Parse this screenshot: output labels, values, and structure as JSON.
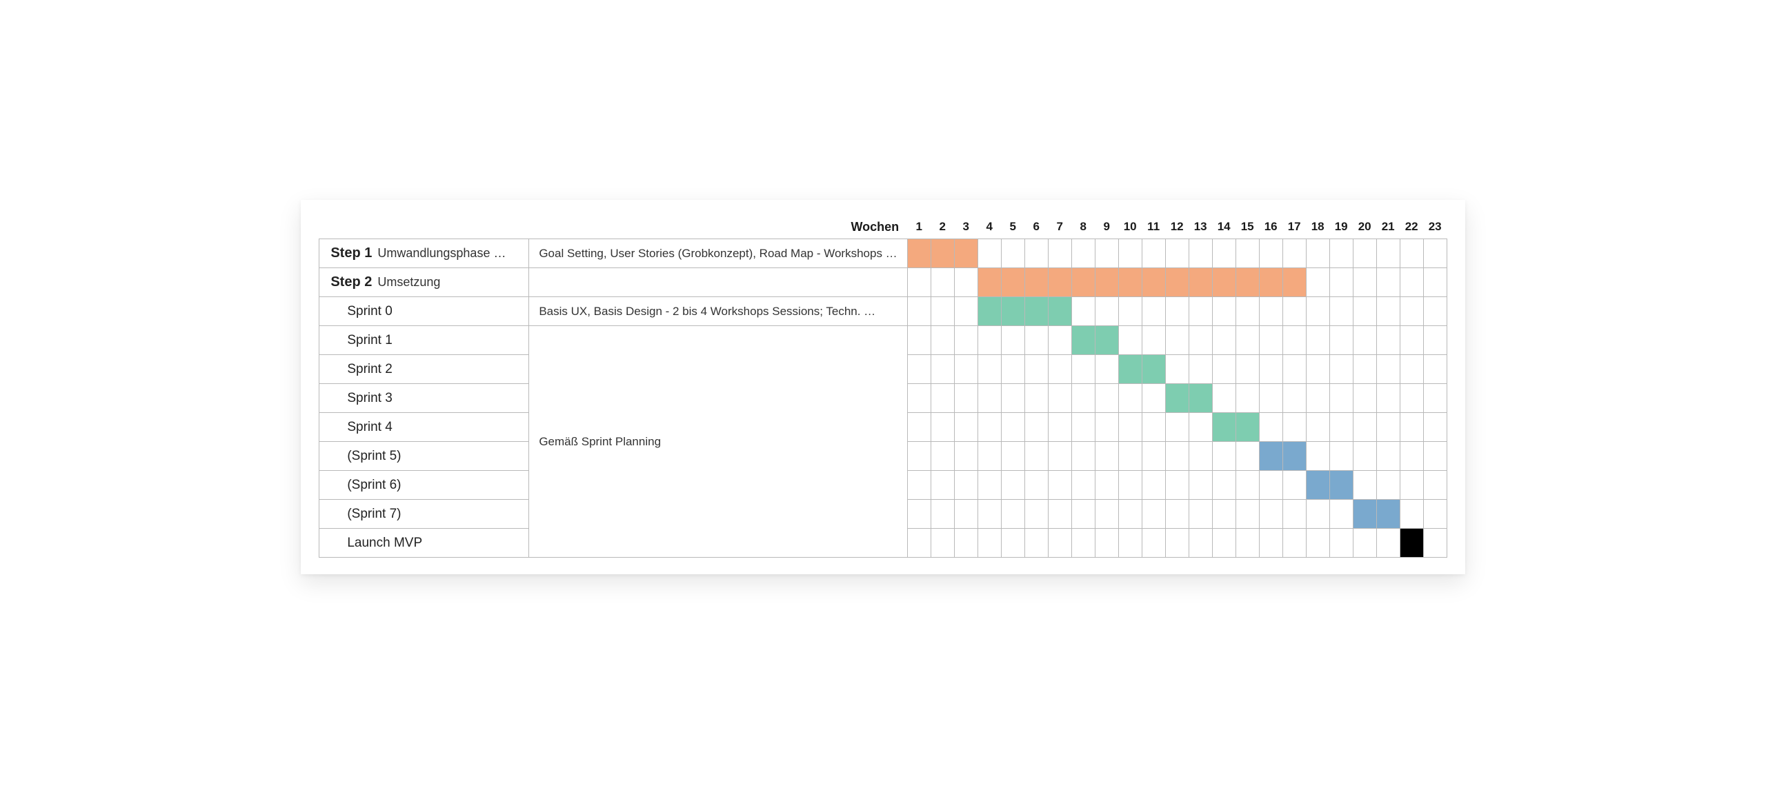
{
  "chart_data": {
    "type": "gantt",
    "title": "",
    "xlabel": "Wochen",
    "categories": [
      1,
      2,
      3,
      4,
      5,
      6,
      7,
      8,
      9,
      10,
      11,
      12,
      13,
      14,
      15,
      16,
      17,
      18,
      19,
      20,
      21,
      22,
      23
    ],
    "colors": {
      "orange": "#f4a97e",
      "green": "#7ecdb0",
      "blue": "#7aa9ce",
      "black": "#000000"
    },
    "rows": [
      {
        "step": "Step 1",
        "sub": "Umwandlungsphase …",
        "indent": false,
        "desc": "Goal Setting, User Stories (Grobkonzept), Road Map - Workshops …",
        "bars": [
          {
            "start": 1,
            "end": 3,
            "color": "orange"
          }
        ]
      },
      {
        "step": "Step 2",
        "sub": "Umsetzung",
        "indent": false,
        "desc": "",
        "bars": [
          {
            "start": 4,
            "end": 17,
            "color": "orange"
          }
        ]
      },
      {
        "name": "Sprint 0",
        "indent": true,
        "desc": "Basis UX, Basis Design - 2 bis 4 Workshops Sessions; Techn.  …",
        "bars": [
          {
            "start": 4,
            "end": 7,
            "color": "green"
          }
        ]
      },
      {
        "name": "Sprint 1",
        "indent": true,
        "desc_group": "Gemäß Sprint Planning",
        "bars": [
          {
            "start": 8,
            "end": 9,
            "color": "green"
          }
        ]
      },
      {
        "name": "Sprint 2",
        "indent": true,
        "bars": [
          {
            "start": 10,
            "end": 11,
            "color": "green"
          }
        ]
      },
      {
        "name": "Sprint 3",
        "indent": true,
        "bars": [
          {
            "start": 12,
            "end": 13,
            "color": "green"
          }
        ]
      },
      {
        "name": "Sprint 4",
        "indent": true,
        "bars": [
          {
            "start": 14,
            "end": 15,
            "color": "green"
          }
        ]
      },
      {
        "name": "(Sprint 5)",
        "indent": true,
        "bars": [
          {
            "start": 16,
            "end": 17,
            "color": "blue"
          }
        ]
      },
      {
        "name": "(Sprint 6)",
        "indent": true,
        "bars": [
          {
            "start": 18,
            "end": 19,
            "color": "blue"
          }
        ]
      },
      {
        "name": "(Sprint 7)",
        "indent": true,
        "bars": [
          {
            "start": 20,
            "end": 21,
            "color": "blue"
          }
        ]
      },
      {
        "name": "Launch MVP",
        "indent": true,
        "bars": [
          {
            "start": 22,
            "end": 22,
            "color": "black"
          }
        ]
      }
    ]
  }
}
